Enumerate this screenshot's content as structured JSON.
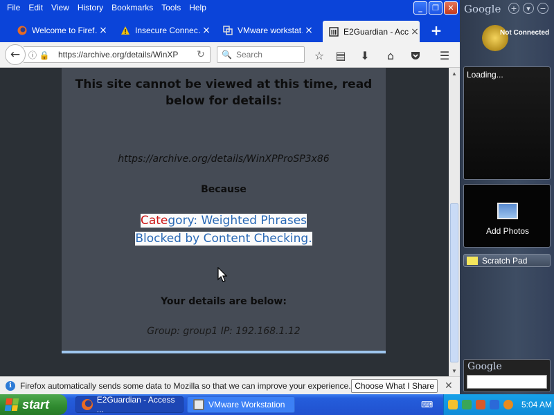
{
  "menu": [
    "File",
    "Edit",
    "View",
    "History",
    "Bookmarks",
    "Tools",
    "Help"
  ],
  "window_controls": {
    "minimize": "_",
    "restore": "❐",
    "close": "✕"
  },
  "tabs": [
    {
      "label": "Welcome to Firef…",
      "icon": "firefox-icon"
    },
    {
      "label": "Insecure Connec…",
      "icon": "warning-icon"
    },
    {
      "label": "VMware workstat…",
      "icon": "vmware-icon"
    },
    {
      "label": "E2Guardian - Acc…",
      "icon": "bank-icon"
    }
  ],
  "new_tab": "+",
  "nav": {
    "url": "https://archive.org/details/WinXP",
    "search_placeholder": "Search"
  },
  "page": {
    "heading": "This site cannot be viewed at this time, read below for details:",
    "blocked_url": "https://archive.org/details/WinXPProSP3x86",
    "because": "Because",
    "reason_red": "Cate",
    "reason_rest1": "gory: Weighted Phrases",
    "reason_line2": "Blocked by Content Checking.",
    "details_heading": "Your details are below:",
    "details": "Group: group1   IP: 192.168.1.12"
  },
  "notification": {
    "text": "Firefox automatically sends some data to Mozilla so that we can improve your experience.",
    "button": "Choose What I Share",
    "close": "✕"
  },
  "sidebar": {
    "logo": "Google",
    "weather_status": "Not Connected",
    "gadget_loading": "Loading...",
    "photos_label": "Add Photos",
    "scratch_label": "Scratch Pad",
    "search_logo": "Google"
  },
  "taskbar": {
    "start": "start",
    "tasks": [
      "E2Guardian - Access ...",
      "VMware Workstation"
    ],
    "clock": "5:04 AM"
  },
  "colors": {
    "xp_blue": "#0b44d9",
    "page_bg": "#454b55",
    "link_blue": "#2868b5",
    "warn_red": "#cc1515"
  }
}
